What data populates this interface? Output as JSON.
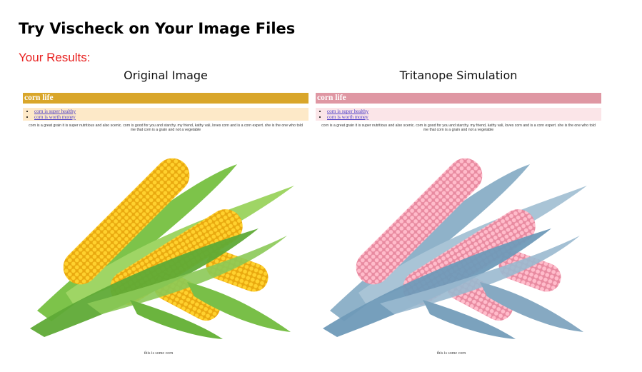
{
  "page": {
    "heading": "Try Vischeck on Your Image Files",
    "results_label": "Your Results:"
  },
  "original": {
    "title": "Original Image",
    "banner": "corn life",
    "links": [
      "corn is super healthy",
      "corn is worth money"
    ],
    "paragraph": "corn is a great grain it is super nutritious and also scenic. corn is good for you and starchy. my friend, kathy vali, loves corn and is a corn expert. she is the one who told me that corn is a grain and not a vegetable",
    "caption": "this is some corn"
  },
  "simulation": {
    "title": "Tritanope Simulation",
    "banner": "corn life",
    "links": [
      "corn is super healthy",
      "corn is worth money"
    ],
    "paragraph": "corn is a great grain it is super nutritious and also scenic. corn is good for you and starchy. my friend, kathy vali, loves corn and is a corn expert. she is the one who told me that corn is a grain and not a vegetable",
    "caption": "this is some corn"
  },
  "colors": {
    "results_label": "#e8201f",
    "original_banner": "#d9a62a",
    "original_list_bg": "#fde9c8",
    "simulation_banner": "#df97a3",
    "simulation_list_bg": "#fbe5e8",
    "link": "#4a3bc8"
  }
}
